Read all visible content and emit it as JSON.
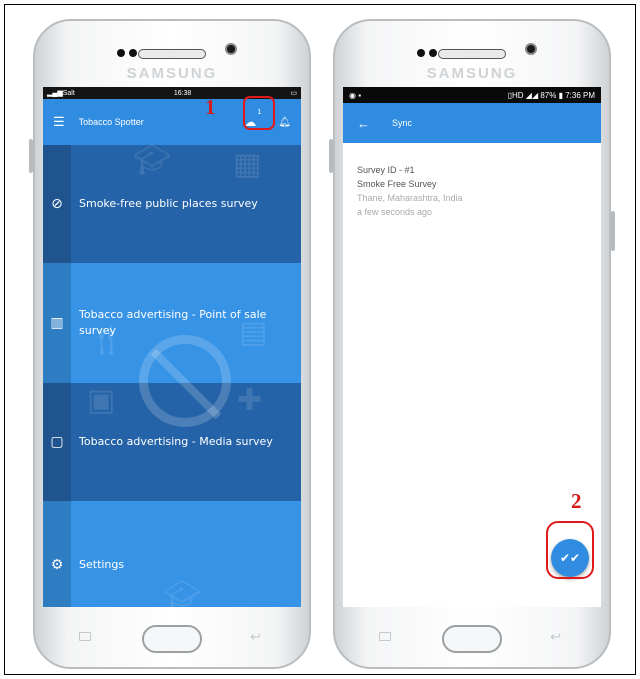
{
  "brand": "SAMSUNG",
  "screen1": {
    "status_bar": {
      "carrier": "Salt",
      "time": "16:38"
    },
    "app_bar": {
      "title": "Tobacco Spotter",
      "sync_badge": "1"
    },
    "menu": [
      {
        "label": "Smoke-free public places survey",
        "icon": "no-smoking-icon"
      },
      {
        "label": "Tobacco advertising - Point of sale survey",
        "icon": "store-icon"
      },
      {
        "label": "Tobacco advertising - Media survey",
        "icon": "tablet-icon"
      },
      {
        "label": "Settings",
        "icon": "gear-icon"
      }
    ],
    "colors": {
      "menu_dark": "#2563a8",
      "menu_light": "#3793e6",
      "app_bar": "#2f8ce0"
    }
  },
  "screen2": {
    "status_bar": {
      "network": "HD",
      "battery": "87%",
      "time": "7:36 PM"
    },
    "app_bar": {
      "title": "Sync"
    },
    "survey": {
      "id": "Survey ID - #1",
      "name": "Smoke Free Survey",
      "location": "Thane, Maharashtra, India",
      "time": "a few seconds ago"
    }
  },
  "annotations": {
    "first": "1",
    "second": "2",
    "color": "#e01a1a"
  }
}
